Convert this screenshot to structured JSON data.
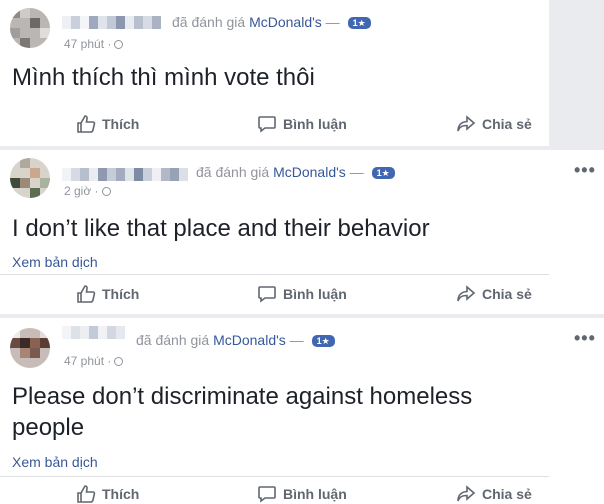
{
  "reviews": [
    {
      "rated_text": "đã đánh giá",
      "place": "McDonald's",
      "dash": "—",
      "stars_badge": "1★",
      "time": "47 phút ·",
      "text": "Mình thích thì mình vote thôi",
      "see_translation": "",
      "actions": {
        "like": "Thích",
        "comment": "Bình luận",
        "share": "Chia sẻ"
      }
    },
    {
      "rated_text": "đã đánh giá",
      "place": "McDonald's",
      "dash": "—",
      "stars_badge": "1★",
      "time": "2 giờ ·",
      "text": "I don’t like that place and their behavior",
      "see_translation": "Xem bản dịch",
      "more": "•••",
      "actions": {
        "like": "Thích",
        "comment": "Bình luận",
        "share": "Chia sẻ"
      }
    },
    {
      "rated_text": "đã đánh giá",
      "place": "McDonald's",
      "dash": "—",
      "stars_badge": "1★",
      "time": "47 phút ·",
      "text_line1": "Please don’t discriminate against homeless",
      "text_line2": "people",
      "see_translation": "Xem bản dịch",
      "more": "•••",
      "actions": {
        "like": "Thích",
        "comment": "Bình luận",
        "share": "Chia sẻ"
      }
    }
  ],
  "colors": {
    "link": "#365899",
    "muted": "#90949c",
    "badge": "#4267b2",
    "action": "#606770"
  }
}
